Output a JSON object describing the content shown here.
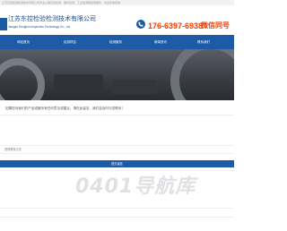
{
  "topbar": {
    "text": "江苏东控检验检测技术有限公司专业从事无损检测、理化检测、工业检测等检测服务，欢迎来电咨询"
  },
  "header": {
    "company_cn": "江苏东控检验检测技术有限公司",
    "company_en": "Jiangsu Dongkon Inspection Technology Co., Ltd",
    "phone": "176-6397-6938",
    "wechat_label": "微信同号"
  },
  "nav": {
    "items": [
      {
        "label": "网站首页"
      },
      {
        "label": "检测项目"
      },
      {
        "label": "检测服务"
      },
      {
        "label": "新闻资讯"
      },
      {
        "label": "联系我们"
      }
    ]
  },
  "content": {
    "notice": "如果您对我们的产品或服务有任何意见或建议，请在此留言，我们会及时与您联系！",
    "contact_label": "您的联系方式",
    "submit_label": "提交留言"
  },
  "watermark": {
    "text": "0401导航库"
  },
  "colors": {
    "brand_blue": "#1d5ba6",
    "phone_orange": "#e8420a"
  }
}
